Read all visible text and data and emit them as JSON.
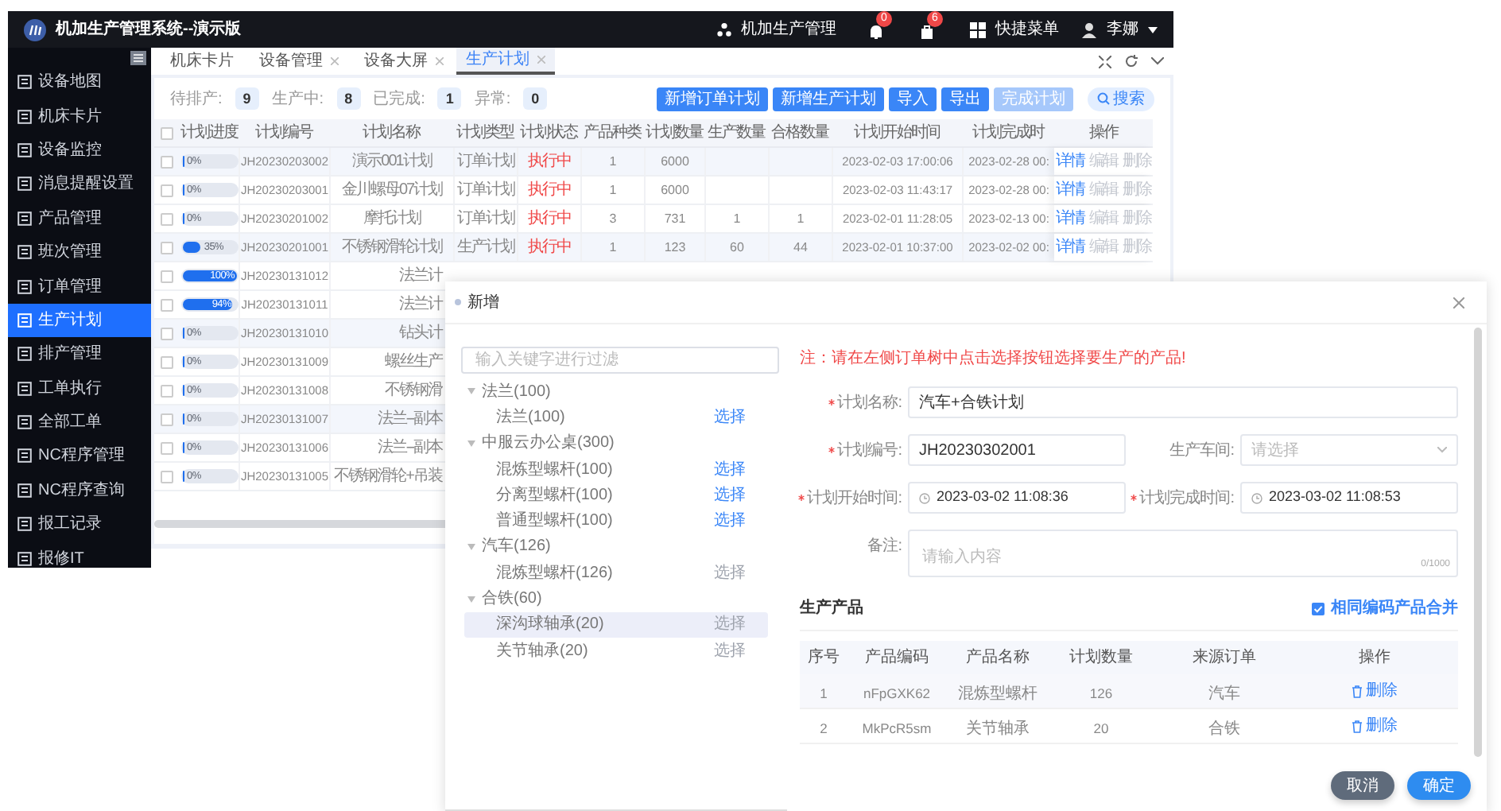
{
  "app": {
    "title": "机加生产管理系统--演示版",
    "org": "机加生产管理",
    "notifications": [
      {
        "kind": "bell",
        "count": "0"
      },
      {
        "kind": "bag",
        "count": "6"
      }
    ],
    "quick_menu": "快捷菜单",
    "user": "李娜"
  },
  "sidebar": {
    "items": [
      {
        "label": "设备地图",
        "selected": false
      },
      {
        "label": "机床卡片",
        "selected": false
      },
      {
        "label": "设备监控",
        "selected": false
      },
      {
        "label": "消息提醒设置",
        "selected": false
      },
      {
        "label": "产品管理",
        "selected": false
      },
      {
        "label": "班次管理",
        "selected": false
      },
      {
        "label": "订单管理",
        "selected": false
      },
      {
        "label": "生产计划",
        "selected": true
      },
      {
        "label": "排产管理",
        "selected": false
      },
      {
        "label": "工单执行",
        "selected": false
      },
      {
        "label": "全部工单",
        "selected": false
      },
      {
        "label": "NC程序管理",
        "selected": false
      },
      {
        "label": "NC程序查询",
        "selected": false
      },
      {
        "label": "报工记录",
        "selected": false
      },
      {
        "label": "报修IT",
        "selected": false
      }
    ]
  },
  "tabs": [
    {
      "label": "机床卡片",
      "closable": false,
      "selected": false
    },
    {
      "label": "设备管理",
      "closable": true,
      "selected": false
    },
    {
      "label": "设备大屏",
      "closable": true,
      "selected": false
    },
    {
      "label": "生产计划",
      "closable": true,
      "selected": true
    }
  ],
  "stats": [
    {
      "label": "待排产:",
      "value": "9"
    },
    {
      "label": "生产中:",
      "value": "8"
    },
    {
      "label": "已完成:",
      "value": "1"
    },
    {
      "label": "异常:",
      "value": "0"
    }
  ],
  "toolbar": {
    "buttons": [
      {
        "label": "新增订单计划",
        "disabled": false
      },
      {
        "label": "新增生产计划",
        "disabled": false
      },
      {
        "label": "导入",
        "disabled": false
      },
      {
        "label": "导出",
        "disabled": false
      },
      {
        "label": "完成计划",
        "disabled": true
      }
    ],
    "search": "搜索"
  },
  "table": {
    "all_checked": false,
    "columns": [
      "计划进度",
      "计划编号",
      "计划名称",
      "计划类型",
      "计划状态",
      "产品种类",
      "计划数量",
      "生产数量",
      "合格数量",
      "计划开始时间",
      "计划完成时",
      "操作"
    ],
    "rows": [
      {
        "checked": false,
        "highlighted": true,
        "progress": "0%",
        "level": 0,
        "code": "JH20230203002",
        "name": "演示001计划",
        "type": "订单计划",
        "status": "执行中",
        "kinds": "1",
        "qty": "6000",
        "start": "2023-02-03 17:00:06",
        "end": "2023-02-28 00:",
        "actions": [
          {
            "label": "详情",
            "disabled": false
          },
          {
            "label": "编辑",
            "disabled": true
          },
          {
            "label": "删除",
            "disabled": true
          }
        ]
      },
      {
        "checked": false,
        "highlighted": false,
        "progress": "0%",
        "level": 0,
        "code": "JH20230203001",
        "name": "金川螺母07计划",
        "type": "订单计划",
        "status": "执行中",
        "kinds": "1",
        "qty": "6000",
        "start": "2023-02-03 11:43:17",
        "end": "2023-02-28 00:",
        "actions": [
          {
            "label": "详情",
            "disabled": false
          },
          {
            "label": "编辑",
            "disabled": true
          },
          {
            "label": "删除",
            "disabled": true
          }
        ]
      },
      {
        "checked": false,
        "highlighted": false,
        "progress": "0%",
        "level": 0,
        "code": "JH20230201002",
        "name": "摩托计划",
        "type": "订单计划",
        "status": "执行中",
        "kinds": "3",
        "qty": "731",
        "produced": "1",
        "qualified": "1",
        "start": "2023-02-01 11:28:05",
        "end": "2023-02-13 00:",
        "actions": [
          {
            "label": "详情",
            "disabled": false
          },
          {
            "label": "编辑",
            "disabled": true
          },
          {
            "label": "删除",
            "disabled": true
          }
        ]
      },
      {
        "checked": false,
        "highlighted": true,
        "progress": "35%",
        "level": 0.35,
        "code": "JH20230201001",
        "name": "不锈钢滑轮计划",
        "type": "生产计划",
        "status": "执行中",
        "kinds": "1",
        "qty": "123",
        "produced": "60",
        "qualified": "44",
        "start": "2023-02-01 10:37:00",
        "end": "2023-02-02 00:",
        "actions": [
          {
            "label": "详情",
            "disabled": false
          },
          {
            "label": "编辑",
            "disabled": true
          },
          {
            "label": "删除",
            "disabled": true
          }
        ]
      },
      {
        "checked": false,
        "highlighted": false,
        "progress": "100%",
        "level": 1,
        "code": "JH20230131012",
        "name": "法兰计"
      },
      {
        "checked": false,
        "highlighted": false,
        "progress": "94%",
        "level": 0.94,
        "code": "JH20230131011",
        "name": "法兰计"
      },
      {
        "checked": false,
        "highlighted": true,
        "progress": "0%",
        "level": 0,
        "code": "JH20230131010",
        "name": "钻头计"
      },
      {
        "checked": false,
        "highlighted": false,
        "progress": "0%",
        "level": 0,
        "code": "JH20230131009",
        "name": "螺丝生产"
      },
      {
        "checked": false,
        "highlighted": false,
        "progress": "0%",
        "level": 0,
        "code": "JH20230131008",
        "name": "不锈钢滑"
      },
      {
        "checked": false,
        "highlighted": true,
        "progress": "0%",
        "level": 0,
        "code": "JH20230131007",
        "name": "法兰--副本"
      },
      {
        "checked": false,
        "highlighted": false,
        "progress": "0%",
        "level": 0,
        "code": "JH20230131006",
        "name": "法兰--副本"
      },
      {
        "checked": false,
        "highlighted": false,
        "progress": "0%",
        "level": 0,
        "code": "JH20230131005",
        "name": "不锈钢滑轮+吊装"
      }
    ]
  },
  "dialog": {
    "title": "新增",
    "filter_placeholder": "输入关键字进行过滤",
    "tree": [
      {
        "label": "法兰(100)",
        "expanded": true,
        "children": [
          {
            "label": "法兰(100)",
            "action": "选择",
            "disabled": false,
            "selected": false
          }
        ]
      },
      {
        "label": "中服云办公桌(300)",
        "expanded": true,
        "children": [
          {
            "label": "混炼型螺杆(100)",
            "action": "选择",
            "disabled": false,
            "selected": false
          },
          {
            "label": "分离型螺杆(100)",
            "action": "选择",
            "disabled": false,
            "selected": false
          },
          {
            "label": "普通型螺杆(100)",
            "action": "选择",
            "disabled": false,
            "selected": false
          }
        ]
      },
      {
        "label": "汽车(126)",
        "expanded": true,
        "children": [
          {
            "label": "混炼型螺杆(126)",
            "action": "选择",
            "disabled": true,
            "selected": false
          }
        ]
      },
      {
        "label": "合铁(60)",
        "expanded": true,
        "children": [
          {
            "label": "深沟球轴承(20)",
            "action": "选择",
            "disabled": true,
            "selected": true
          },
          {
            "label": "关节轴承(20)",
            "action": "选择",
            "disabled": true,
            "selected": false
          }
        ]
      }
    ],
    "note": "注：请在左侧订单树中点击选择按钮选择要生产的产品!",
    "form_rows": [
      {
        "fields": [
          {
            "kind": "text",
            "label": "计划名称:",
            "required": true,
            "value": "汽车+合铁计划"
          }
        ]
      },
      {
        "fields": [
          {
            "kind": "text",
            "label": "计划编号:",
            "required": true,
            "value": "JH20230302001"
          },
          {
            "kind": "select",
            "label": "生产车间:",
            "required": false,
            "placeholder": "请选择"
          }
        ]
      },
      {
        "fields": [
          {
            "kind": "datetime",
            "label": "计划开始时间:",
            "required": true,
            "value": "2023-03-02 11:08:36"
          },
          {
            "kind": "datetime",
            "label": "计划完成时间:",
            "required": true,
            "value": "2023-03-02 11:08:53"
          }
        ]
      },
      {
        "fields": [
          {
            "kind": "textarea",
            "label": "备注:",
            "required": false,
            "placeholder": "请输入内容",
            "counter": "0/1000"
          }
        ]
      }
    ],
    "products": {
      "title": "生产产品",
      "merge": {
        "label": "相同编码产品合并",
        "checked": true
      },
      "columns": [
        "序号",
        "产品编码",
        "产品名称",
        "计划数量",
        "来源订单",
        "操作"
      ],
      "rows": [
        {
          "index": "1",
          "code": "nFpGXK62",
          "name": "混炼型螺杆",
          "qty": "126",
          "source": "汽车",
          "action": "删除"
        },
        {
          "index": "2",
          "code": "MkPcR5sm",
          "name": "关节轴承",
          "qty": "20",
          "source": "合铁",
          "action": "删除"
        }
      ]
    },
    "buttons": [
      {
        "kind": "cancel",
        "label": "取消"
      },
      {
        "kind": "confirm",
        "label": "确定"
      }
    ]
  }
}
